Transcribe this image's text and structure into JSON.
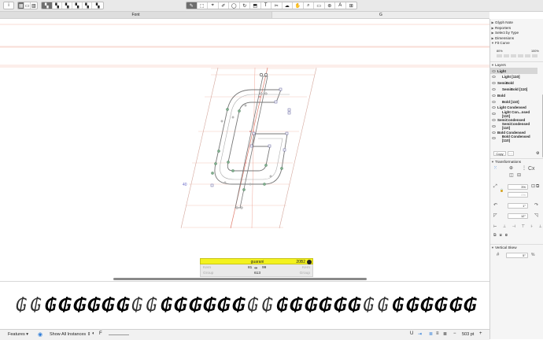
{
  "toolbar": {
    "info_icon": "i",
    "edit_tools": [
      "✎",
      "⬚",
      "⌖",
      "✐",
      "◯",
      "↻",
      "⬒",
      "T",
      "✂",
      "☁",
      "✋",
      "⌕",
      "▭",
      "⊛",
      "A",
      "⊞"
    ]
  },
  "tabs": {
    "font": "Font",
    "glyph": "G"
  },
  "canvas": {
    "metric_label": "40",
    "info": {
      "glyph_name": "guarani",
      "unicode": "20B2",
      "left_label": "Kern",
      "right_label": "Kern",
      "left_sidebearing": "81",
      "right_sidebearing": "99",
      "width_label": "Group",
      "width_label_right": "Group",
      "width": "613"
    }
  },
  "preview": {
    "glyph": "₲",
    "count": 32
  },
  "bottombar": {
    "features": "Features",
    "instances": "Show All Instances",
    "font_indicator": "F",
    "size": "503 pt"
  },
  "side": {
    "sections": [
      "Glyph Note",
      "Reporters",
      "Select by Type",
      "Dimensions",
      "Fit Curve"
    ],
    "fit_curve": {
      "left": "80%",
      "right": "100%"
    },
    "layers_title": "Layers",
    "layers": [
      {
        "label": "Light",
        "master": true
      },
      {
        "label": "Light [110]",
        "master": false
      },
      {
        "label": "SemiBold",
        "master": true
      },
      {
        "label": "SemiBold [110]",
        "master": false
      },
      {
        "label": "Bold",
        "master": true
      },
      {
        "label": "Bold [110]",
        "master": false
      },
      {
        "label": "Light Condensed",
        "master": true
      },
      {
        "label": "Light Con...nsed [110]",
        "master": false
      },
      {
        "label": "SemiCondensed",
        "master": true
      },
      {
        "label": "SemiCondensed [110]",
        "master": false
      },
      {
        "label": "Bold Condensed",
        "master": true
      },
      {
        "label": "Bold Condensed [110]",
        "master": false
      }
    ],
    "copy_button": "Copy",
    "transformations_title": "Transformations",
    "scale_value": "3%",
    "scale_value2": "0%",
    "rotate_value": "1°",
    "slant_value": "12°",
    "vertical_skew_title": "Vertical Skew",
    "vskew_value": "5°",
    "vskew_unit": "%"
  },
  "colors": {
    "accent": "#2a7ad8",
    "highlight": "#f3f21e",
    "metric_line": "#e8a08a"
  }
}
